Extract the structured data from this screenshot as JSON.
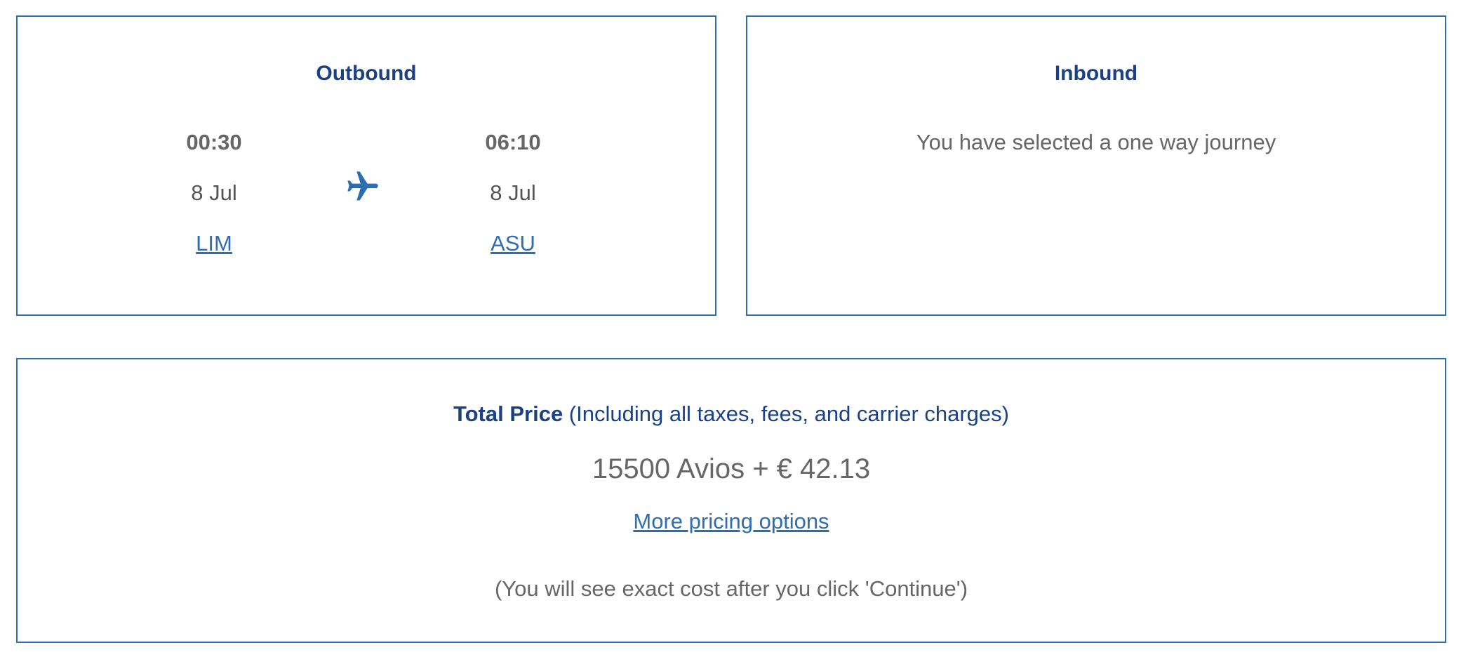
{
  "outbound": {
    "heading": "Outbound",
    "departure": {
      "time": "00:30",
      "date": "8 Jul",
      "airport": "LIM"
    },
    "arrival": {
      "time": "06:10",
      "date": "8 Jul",
      "airport": "ASU"
    },
    "icon": "airplane-icon"
  },
  "inbound": {
    "heading": "Inbound",
    "message": "You have selected a one way journey"
  },
  "price": {
    "title_bold": "Total Price",
    "title_note": " (Including all taxes, fees, and carrier charges)",
    "amount": "15500 Avios + € 42.13",
    "more_options": "More pricing options",
    "note": "(You will see exact cost after you click 'Continue')"
  },
  "colors": {
    "border": "#2f6db3",
    "heading": "#1b4184",
    "link": "#2f6db3",
    "text": "#666666"
  }
}
